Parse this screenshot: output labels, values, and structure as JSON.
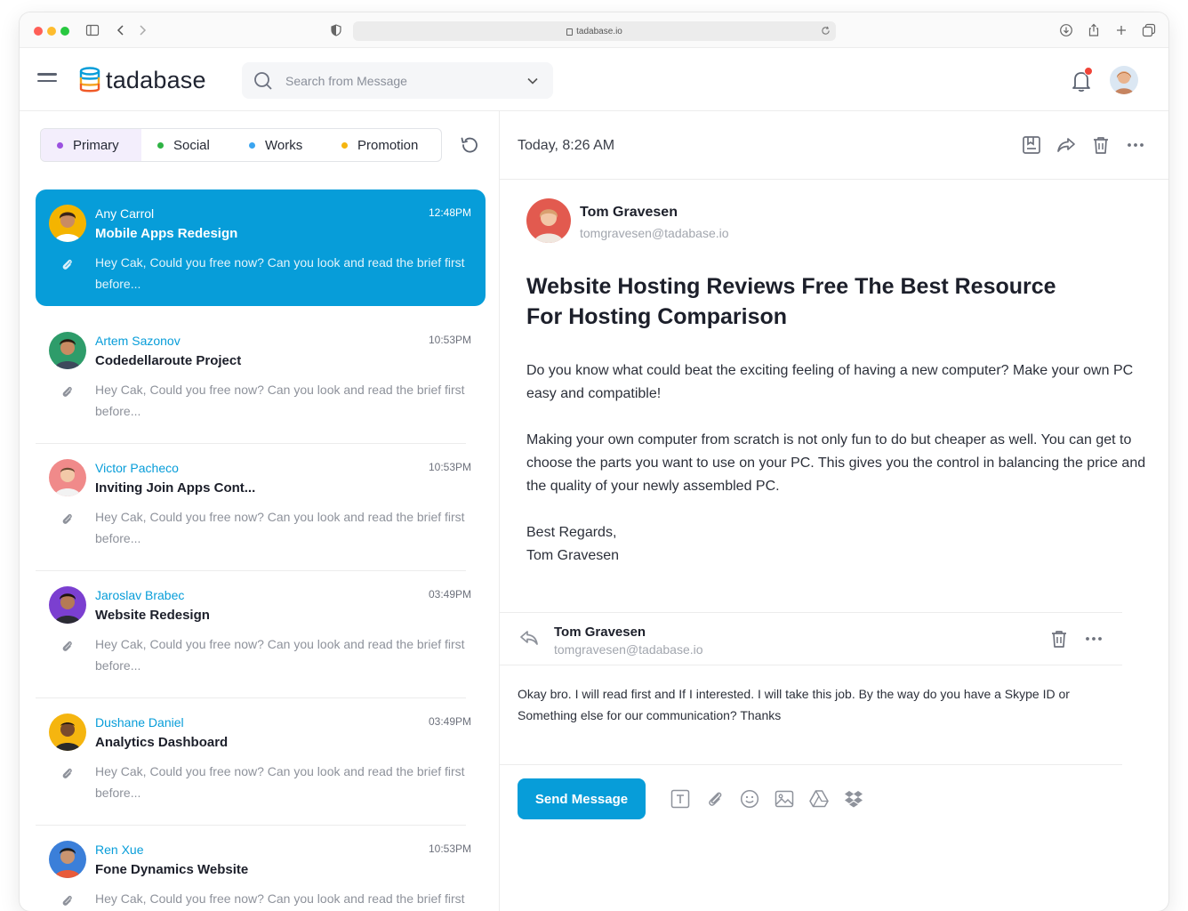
{
  "browser": {
    "url": "tadabase.io"
  },
  "app": {
    "logo_text": "tadabase",
    "search_placeholder": "Search from Message"
  },
  "tabs": [
    {
      "label": "Primary",
      "color": "#9b51e0"
    },
    {
      "label": "Social",
      "color": "#2fb344"
    },
    {
      "label": "Works",
      "color": "#3ba5f0"
    },
    {
      "label": "Promotion",
      "color": "#f5b50f"
    }
  ],
  "mails": [
    {
      "sender": "Any Carrol",
      "time": "12:48PM",
      "subject": "Mobile Apps Redesign",
      "snippet": "Hey Cak, Could you free now? Can you look and read the brief first before...",
      "avatar_color": "#f4b400"
    },
    {
      "sender": "Artem Sazonov",
      "time": "10:53PM",
      "subject": "Codedellaroute Project",
      "snippet": "Hey Cak, Could you free now? Can you look and read the brief first before...",
      "avatar_color": "#2e9c6a"
    },
    {
      "sender": "Victor Pacheco",
      "time": "10:53PM",
      "subject": "Inviting Join Apps Cont...",
      "snippet": "Hey Cak, Could you free now? Can you look and read the brief first before...",
      "avatar_color": "#f08a8a"
    },
    {
      "sender": "Jaroslav Brabec",
      "time": "03:49PM",
      "subject": "Website Redesign",
      "snippet": "Hey Cak, Could you free now? Can you look and read the brief first before...",
      "avatar_color": "#7b3fd0"
    },
    {
      "sender": "Dushane Daniel",
      "time": "03:49PM",
      "subject": "Analytics Dashboard",
      "snippet": "Hey Cak, Could you free now? Can you look and read the brief first before...",
      "avatar_color": "#f5b50f"
    },
    {
      "sender": "Ren Xue",
      "time": "10:53PM",
      "subject": "Fone Dynamics Website",
      "snippet": "Hey Cak, Could you free now? Can you look and read the brief first before...",
      "avatar_color": "#3b7fd9"
    }
  ],
  "message": {
    "date": "Today, 8:26 AM",
    "from_name": "Tom Gravesen",
    "from_email": "tomgravesen@tadabase.io",
    "title": "Website Hosting Reviews Free The Best Resource For Hosting Comparison",
    "para1": "Do you know what could beat the exciting feeling of having a new computer? Make your own PC easy and compatible!",
    "para2": "Making your own computer from scratch is not only fun to do but cheaper as well. You can get to choose the parts you want to use on your PC. This gives you the control in balancing the price and the quality of your newly assembled PC.",
    "regards": "Best Regards,",
    "signature": "Tom Gravesen"
  },
  "reply": {
    "name": "Tom Gravesen",
    "email": "tomgravesen@tadabase.io",
    "text": "Okay bro. I will read first and If I interested. I will take this job. By the way do you have a Skype ID or Something else for our communication? Thanks"
  },
  "compose": {
    "send_label": "Send Message"
  },
  "colors": {
    "accent": "#079dd9",
    "notification": "#f04438"
  }
}
